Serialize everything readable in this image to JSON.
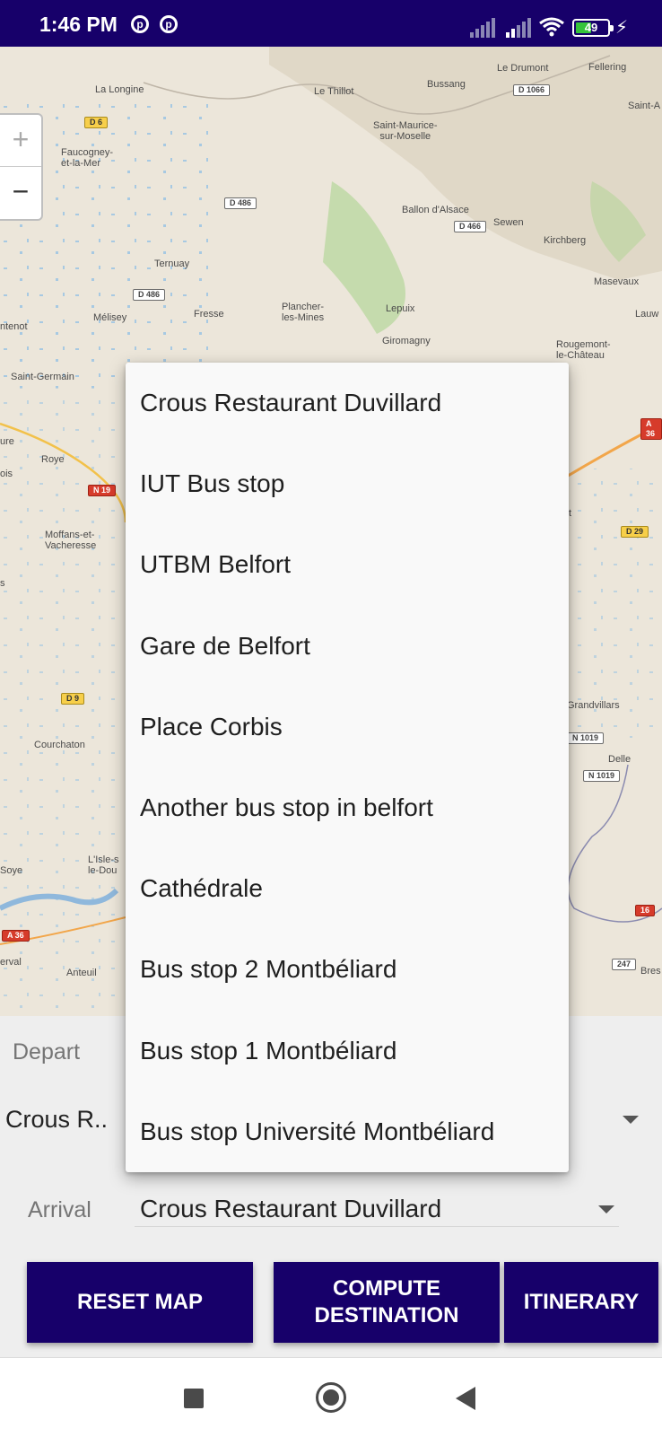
{
  "status_bar": {
    "time": "1:46 PM",
    "battery_level": "49",
    "battery_fraction": 0.49,
    "icons": [
      "circle-p-icon",
      "circle-p-icon",
      "signal-icon",
      "signal-icon",
      "wifi-icon",
      "battery-icon",
      "charging-bolt-icon"
    ]
  },
  "map": {
    "zoom_in_label": "+",
    "zoom_out_label": "−",
    "places": [
      "Le Drumont",
      "Fellering",
      "La Longine",
      "Le Thillot",
      "Bussang",
      "Saint-A",
      "Saint-Maurice-\nsur-Moselle",
      "Faucogney-\net-la-Mer",
      "Ballon d'Alsace",
      "Sewen",
      "Kirchberg",
      "Ternuay",
      "Masevaux",
      "ntenot",
      "Mélisey",
      "Fresse",
      "Plancher-\nles-Mines",
      "Lepuix",
      "Lauw",
      "Giromagny",
      "Rougemont-\nle-Château",
      "Saint-Germain",
      "ure",
      "Roye",
      "ois",
      "Moffans-et-\nVacheresse",
      "s",
      "Courchaton",
      "Grandvillars",
      "Delle",
      "L'Isle-s\nle-Dou",
      "Soye",
      "erval",
      "Anteuil",
      "Bres",
      "t"
    ],
    "roads": [
      "D 6",
      "D 486",
      "D 486",
      "D 1066",
      "D 466",
      "N 19",
      "D 9",
      "A 36",
      "D 29",
      "N 1019",
      "N 1019",
      "A 36",
      "16",
      "247"
    ]
  },
  "form": {
    "depart_label": "Depart",
    "depart_value": "Crous R..",
    "arrival_label": "Arrival",
    "arrival_value": "Crous Restaurant Duvillard"
  },
  "buttons": {
    "reset_map": "RESET MAP",
    "compute_destination_line1": "COMPUTE",
    "compute_destination_line2": "DESTINATION",
    "itinerary": "ITINERARY"
  },
  "dropdown": {
    "options": [
      "Crous Restaurant Duvillard",
      "IUT Bus stop",
      "UTBM Belfort",
      "Gare de Belfort",
      "Place Corbis",
      "Another bus stop in belfort",
      "Cathédrale",
      "Bus stop 2 Montbéliard",
      "Bus stop 1 Montbéliard",
      "Bus stop Université Montbéliard"
    ]
  },
  "colors": {
    "status_bar": "#17006a",
    "button": "#17006a",
    "battery_fill": "#35c43a",
    "map_background": "#ece6da",
    "water": "#9fc6e3",
    "forest": "#b5d69a"
  }
}
